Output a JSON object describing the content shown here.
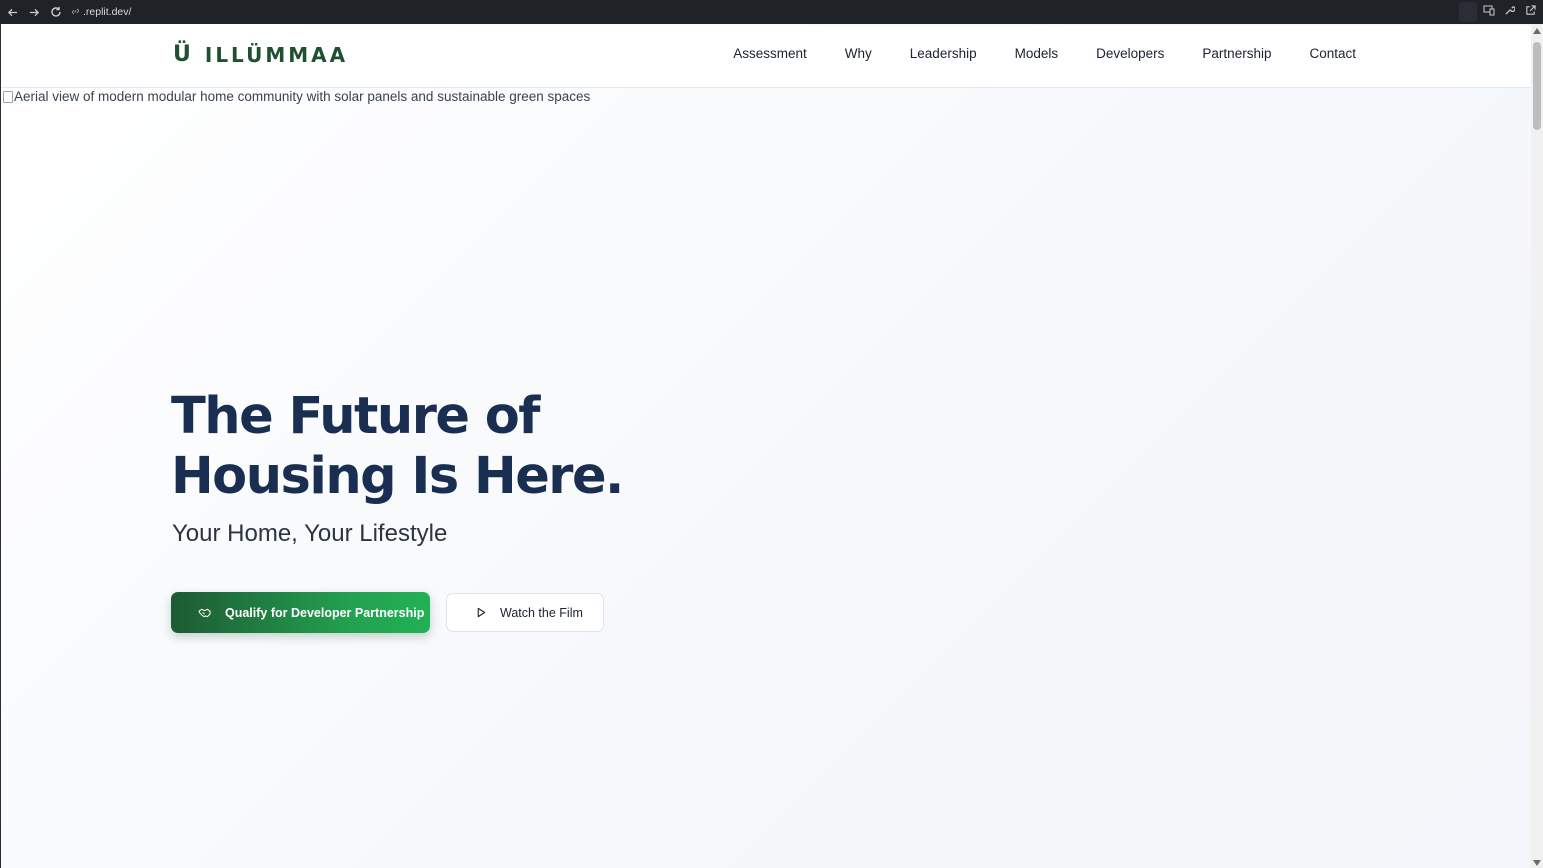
{
  "browser": {
    "url": ".replit.dev/",
    "back_icon": "arrow-left-icon",
    "forward_icon": "arrow-right-icon",
    "reload_icon": "reload-icon"
  },
  "header": {
    "logo_mark": "Ü",
    "logo_text": "ILLÜMMAA",
    "nav": [
      {
        "label": "Assessment"
      },
      {
        "label": "Why"
      },
      {
        "label": "Leadership"
      },
      {
        "label": "Models"
      },
      {
        "label": "Developers"
      },
      {
        "label": "Partnership"
      },
      {
        "label": "Contact"
      }
    ]
  },
  "hero": {
    "image_alt": "Aerial view of modern modular home community with solar panels and sustainable green spaces",
    "title_line1": "The Future of",
    "title_line2": "Housing Is Here.",
    "subtitle": "Your Home, Your Lifestyle",
    "primary_button": "Qualify for Developer Partnership",
    "secondary_button": "Watch the Film"
  },
  "colors": {
    "brand_green": "#1f5130",
    "heading_navy": "#1a2e52",
    "button_gradient_start": "#1d5a33",
    "button_gradient_end": "#22b155"
  }
}
